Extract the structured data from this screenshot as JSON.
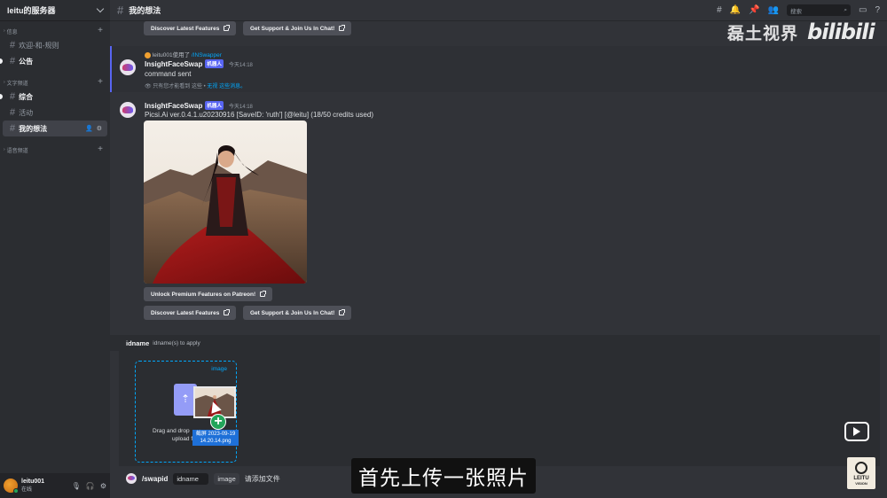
{
  "server": {
    "name": "leitu的服务器"
  },
  "categories": {
    "info": "信息",
    "text": "文字频道",
    "voice": "语音频道"
  },
  "channels": {
    "info": [
      {
        "name": "欢迎-和-规则"
      },
      {
        "name": "公告"
      }
    ],
    "text": [
      {
        "name": "综合"
      },
      {
        "name": "活动"
      },
      {
        "name": "我的想法"
      }
    ]
  },
  "user": {
    "name": "leitu001",
    "status": "在线"
  },
  "topbar": {
    "channel": "我的想法",
    "search_placeholder": "搜索"
  },
  "buttons": {
    "discover": "Discover Latest Features",
    "support": "Get Support & Join Us In Chat!",
    "premium": "Unlock Premium Features on Patreon!"
  },
  "message1": {
    "reply_user": "leitu001",
    "reply_used": "使用了",
    "reply_cmd": "/INSwapper",
    "author": "InsightFaceSwap",
    "badge": "机器人",
    "time": "今天14:18",
    "text": "command sent",
    "ephemeral_note": "只有您才能看到 这些 •",
    "ephemeral_link": "无视 这些消息。"
  },
  "message2": {
    "author": "InsightFaceSwap",
    "badge": "机器人",
    "time": "今天14:18",
    "text": "Picsi.Ai ver.0.4.1.u20230916 [SaveID: 'ruth'] [@leitu] (18/50 credits used)"
  },
  "options": {
    "param_name": "idname",
    "param_desc": "idname(s) to apply"
  },
  "upload": {
    "label": "image",
    "drag_text_1": "Drag and drop",
    "drag_text_2": "upload f",
    "file_line1": "截屏 2023-09-19",
    "file_line2": "14.20.14.png"
  },
  "command": {
    "name": "/swapid",
    "chip1": "idname",
    "chip2": "image",
    "chip2_value": "请添加文件"
  },
  "overlay": {
    "watermark_cn": "磊土视界",
    "watermark_bili": "bilibili",
    "subtitle": "首先上传一张照片",
    "logo_text": "LEITU",
    "logo_sub": "VISION"
  },
  "colors": {
    "accent": "#5865f2",
    "link": "#00a8fc",
    "online": "#23a55a"
  }
}
